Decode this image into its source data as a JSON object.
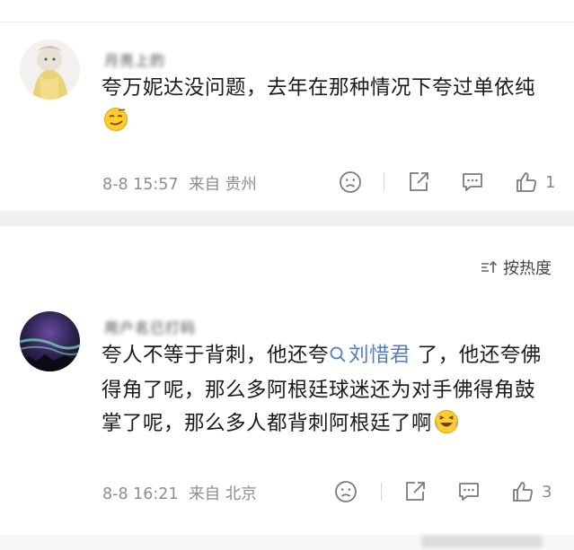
{
  "comments": [
    {
      "username": "月亮上的",
      "text": "夸万妮达没问题，去年在那种情况下夸过单依纯",
      "time": "8-8 15:57",
      "location": "来自 贵州",
      "like_count": "1",
      "emoji": "smirk-face"
    },
    {
      "username": "用户名已打码",
      "text_part1": "夸人不等于背刺，他还夸",
      "topic_link": "刘惜君",
      "text_part2": "了，他还夸佛得角了呢，那么多阿根廷球迷还为对手佛得角鼓掌了呢，那么多人都背刺阿根廷了啊",
      "time": "8-8 16:21",
      "location": "来自 北京",
      "like_count": "3",
      "emoji": "laughing-tears-face"
    }
  ],
  "sort": {
    "label": "按热度",
    "icon": "sort-icon"
  },
  "colors": {
    "link": "#4f7fbf",
    "meta": "#8d8d8d",
    "band": "#f0f0f0"
  }
}
